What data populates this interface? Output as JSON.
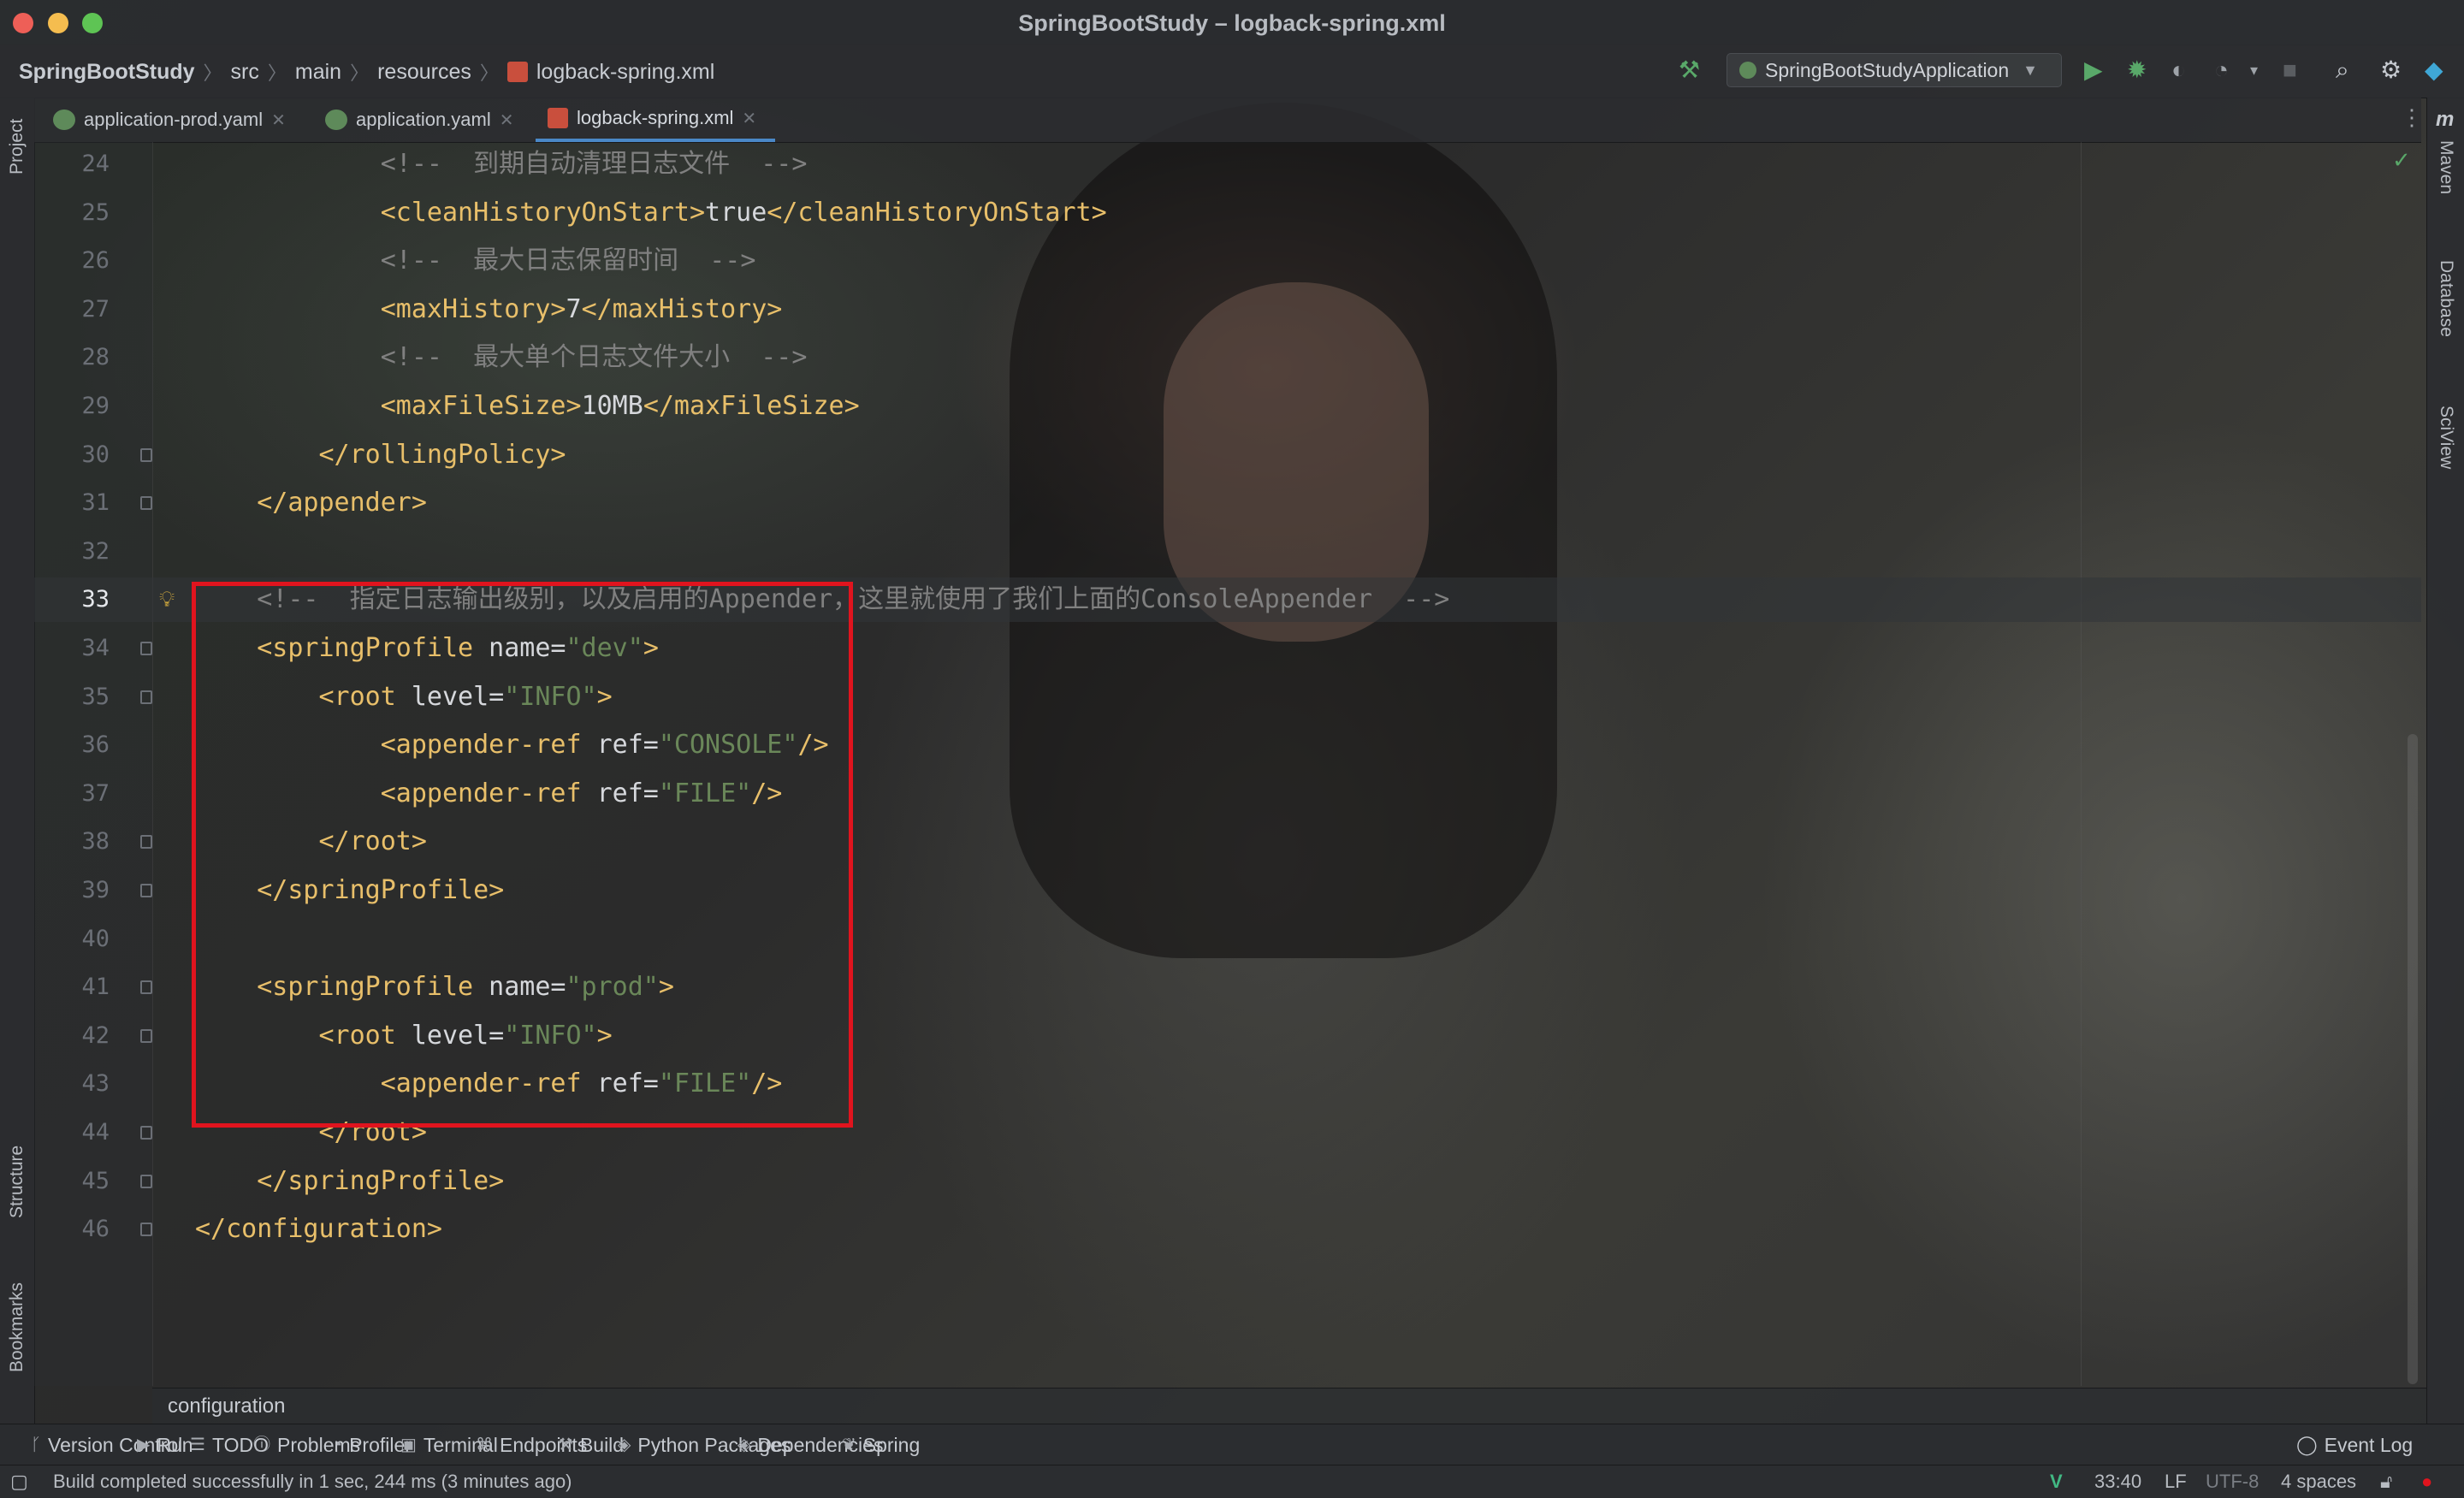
{
  "window": {
    "title": "SpringBootStudy – logback-spring.xml"
  },
  "breadcrumb": {
    "project": "SpringBootStudy",
    "src": "src",
    "main": "main",
    "resources": "resources",
    "file": "logback-spring.xml"
  },
  "run_config": {
    "label": "SpringBootStudyApplication"
  },
  "tabs": [
    {
      "label": "application-prod.yaml"
    },
    {
      "label": "application.yaml"
    },
    {
      "label": "logback-spring.xml"
    }
  ],
  "left_strip": {
    "project": "Project",
    "structure": "Structure",
    "bookmarks": "Bookmarks"
  },
  "right_strip": {
    "maven": "Maven",
    "database": "Database",
    "sciview": "SciView"
  },
  "editor": {
    "current_line": "33",
    "lines": [
      {
        "num": "24",
        "indent": "        ",
        "comment": "<!--  到期自动清理日志文件  -->"
      },
      {
        "num": "25",
        "indent": "        ",
        "open": "<cleanHistoryOnStart>",
        "text": "true",
        "close": "</cleanHistoryOnStart>"
      },
      {
        "num": "26",
        "indent": "        ",
        "comment": "<!--  最大日志保留时间  -->"
      },
      {
        "num": "27",
        "indent": "        ",
        "open": "<maxHistory>",
        "text": "7",
        "close": "</maxHistory>"
      },
      {
        "num": "28",
        "indent": "        ",
        "comment": "<!--  最大单个日志文件大小  -->"
      },
      {
        "num": "29",
        "indent": "        ",
        "open": "<maxFileSize>",
        "text": "10MB",
        "close": "</maxFileSize>"
      },
      {
        "num": "30",
        "indent": "    ",
        "close": "</rollingPolicy>"
      },
      {
        "num": "31",
        "indent": "",
        "close": "</appender>"
      },
      {
        "num": "32",
        "indent": ""
      },
      {
        "num": "33",
        "indent": "",
        "comment": "<!--  指定日志输出级别，以及启用的Appender，这里就使用了我们上面的ConsoleAppender  -->"
      },
      {
        "num": "34",
        "indent": "",
        "tag": "<springProfile",
        "attr": " name=",
        "val": "\"dev\"",
        "end": ">"
      },
      {
        "num": "35",
        "indent": "    ",
        "tag": "<root",
        "attr": " level=",
        "val": "\"INFO\"",
        "end": ">"
      },
      {
        "num": "36",
        "indent": "        ",
        "tag": "<appender-ref",
        "attr": " ref=",
        "val": "\"CONSOLE\"",
        "end": "/>"
      },
      {
        "num": "37",
        "indent": "        ",
        "tag": "<appender-ref",
        "attr": " ref=",
        "val": "\"FILE\"",
        "end": "/>"
      },
      {
        "num": "38",
        "indent": "    ",
        "close": "</root>"
      },
      {
        "num": "39",
        "indent": "",
        "close": "</springProfile>"
      },
      {
        "num": "40",
        "indent": ""
      },
      {
        "num": "41",
        "indent": "",
        "tag": "<springProfile",
        "attr": " name=",
        "val": "\"prod\"",
        "end": ">"
      },
      {
        "num": "42",
        "indent": "    ",
        "tag": "<root",
        "attr": " level=",
        "val": "\"INFO\"",
        "end": ">"
      },
      {
        "num": "43",
        "indent": "        ",
        "tag": "<appender-ref",
        "attr": " ref=",
        "val": "\"FILE\"",
        "end": "/>"
      },
      {
        "num": "44",
        "indent": "    ",
        "close": "</root>"
      },
      {
        "num": "45",
        "indent": "",
        "close": "</springProfile>"
      },
      {
        "num": "46",
        "indent": "",
        "close": "</configuration>"
      }
    ]
  },
  "crumb_bottom": "configuration",
  "tool_windows": [
    {
      "label": "Version Control",
      "icon": "branch-icon"
    },
    {
      "label": "Run",
      "icon": "play-icon"
    },
    {
      "label": "TODO",
      "icon": "list-icon"
    },
    {
      "label": "Problems",
      "icon": "info-icon"
    },
    {
      "label": "Profiler",
      "icon": "profiler-icon"
    },
    {
      "label": "Terminal",
      "icon": "terminal-icon"
    },
    {
      "label": "Endpoints",
      "icon": "endpoints-icon"
    },
    {
      "label": "Build",
      "icon": "hammer-icon"
    },
    {
      "label": "Python Packages",
      "icon": "layers-icon"
    },
    {
      "label": "Dependencies",
      "icon": "layers-icon"
    },
    {
      "label": "Spring",
      "icon": "spring-icon"
    }
  ],
  "event_log": "Event Log",
  "status": {
    "message": "Build completed successfully in 1 sec, 244 ms (3 minutes ago)",
    "position": "33:40",
    "line_sep": "LF",
    "encoding": "UTF-8",
    "indent": "4 spaces"
  },
  "colors": {
    "tag": "#e8bf6a",
    "attr_value": "#6a8759",
    "comment": "#808080",
    "highlight_box": "#e0141e",
    "accent": "#4a88c7"
  }
}
